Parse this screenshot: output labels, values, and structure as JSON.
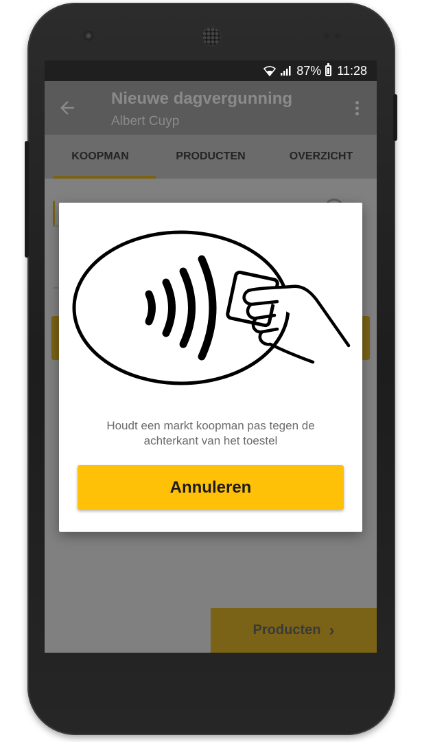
{
  "status_bar": {
    "battery": "87%",
    "time": "11:28",
    "icons": [
      "wifi-icon",
      "signal-icon",
      "battery-icon"
    ]
  },
  "app_bar": {
    "title": "Nieuwe dagvergunning",
    "subtitle": "Albert Cuyp",
    "icons": [
      "back-arrow-icon",
      "more-vert-icon"
    ]
  },
  "tabs": [
    {
      "label": "KOOPMAN",
      "selected": true
    },
    {
      "label": "PRODUCTEN",
      "selected": false
    },
    {
      "label": "OVERZICHT",
      "selected": false
    }
  ],
  "bottom_action": {
    "label": "Producten",
    "icon": "chevron-right-icon"
  },
  "dialog": {
    "illustration": "nfc-contactless-card-icon",
    "message_line1": "Houdt een markt koopman pas tegen de",
    "message_line2": "achterkant van het toestel",
    "cancel_label": "Annuleren"
  },
  "colors": {
    "accent": "#ffc107",
    "dim_overlay_accent": "#7a6316",
    "app_bar": "#5a5a5a",
    "status_bar": "#1f1f1f"
  }
}
